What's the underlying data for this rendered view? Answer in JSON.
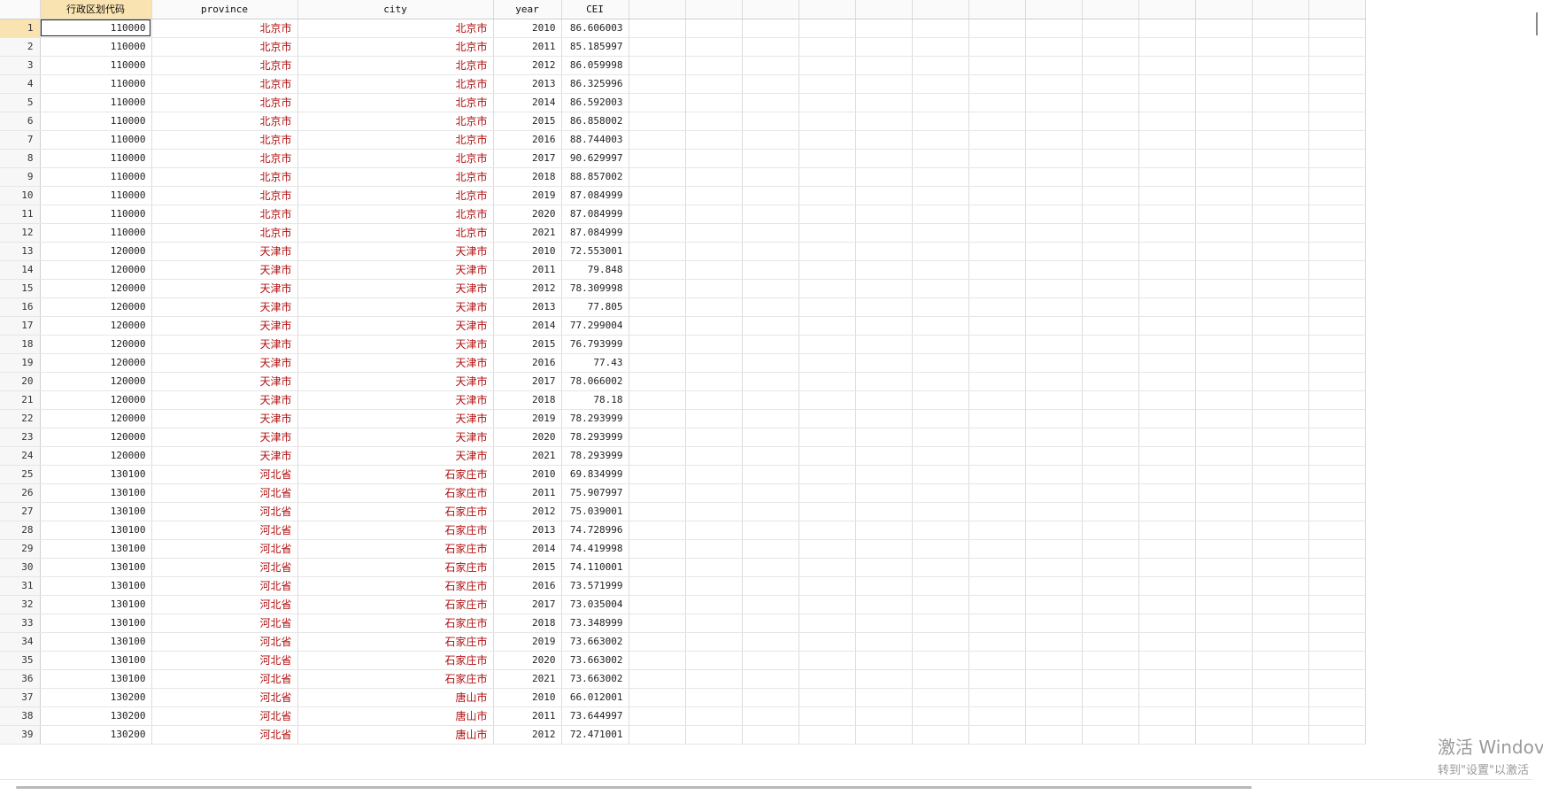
{
  "columns": [
    "行政区划代码",
    "province",
    "city",
    "year",
    "CEI"
  ],
  "selected_row": 1,
  "selected_column": "行政区划代码",
  "extra_empty_columns": 13,
  "rows": [
    [
      "1",
      "110000",
      "北京市",
      "北京市",
      "2010",
      "86.606003"
    ],
    [
      "2",
      "110000",
      "北京市",
      "北京市",
      "2011",
      "85.185997"
    ],
    [
      "3",
      "110000",
      "北京市",
      "北京市",
      "2012",
      "86.059998"
    ],
    [
      "4",
      "110000",
      "北京市",
      "北京市",
      "2013",
      "86.325996"
    ],
    [
      "5",
      "110000",
      "北京市",
      "北京市",
      "2014",
      "86.592003"
    ],
    [
      "6",
      "110000",
      "北京市",
      "北京市",
      "2015",
      "86.858002"
    ],
    [
      "7",
      "110000",
      "北京市",
      "北京市",
      "2016",
      "88.744003"
    ],
    [
      "8",
      "110000",
      "北京市",
      "北京市",
      "2017",
      "90.629997"
    ],
    [
      "9",
      "110000",
      "北京市",
      "北京市",
      "2018",
      "88.857002"
    ],
    [
      "10",
      "110000",
      "北京市",
      "北京市",
      "2019",
      "87.084999"
    ],
    [
      "11",
      "110000",
      "北京市",
      "北京市",
      "2020",
      "87.084999"
    ],
    [
      "12",
      "110000",
      "北京市",
      "北京市",
      "2021",
      "87.084999"
    ],
    [
      "13",
      "120000",
      "天津市",
      "天津市",
      "2010",
      "72.553001"
    ],
    [
      "14",
      "120000",
      "天津市",
      "天津市",
      "2011",
      "79.848"
    ],
    [
      "15",
      "120000",
      "天津市",
      "天津市",
      "2012",
      "78.309998"
    ],
    [
      "16",
      "120000",
      "天津市",
      "天津市",
      "2013",
      "77.805"
    ],
    [
      "17",
      "120000",
      "天津市",
      "天津市",
      "2014",
      "77.299004"
    ],
    [
      "18",
      "120000",
      "天津市",
      "天津市",
      "2015",
      "76.793999"
    ],
    [
      "19",
      "120000",
      "天津市",
      "天津市",
      "2016",
      "77.43"
    ],
    [
      "20",
      "120000",
      "天津市",
      "天津市",
      "2017",
      "78.066002"
    ],
    [
      "21",
      "120000",
      "天津市",
      "天津市",
      "2018",
      "78.18"
    ],
    [
      "22",
      "120000",
      "天津市",
      "天津市",
      "2019",
      "78.293999"
    ],
    [
      "23",
      "120000",
      "天津市",
      "天津市",
      "2020",
      "78.293999"
    ],
    [
      "24",
      "120000",
      "天津市",
      "天津市",
      "2021",
      "78.293999"
    ],
    [
      "25",
      "130100",
      "河北省",
      "石家庄市",
      "2010",
      "69.834999"
    ],
    [
      "26",
      "130100",
      "河北省",
      "石家庄市",
      "2011",
      "75.907997"
    ],
    [
      "27",
      "130100",
      "河北省",
      "石家庄市",
      "2012",
      "75.039001"
    ],
    [
      "28",
      "130100",
      "河北省",
      "石家庄市",
      "2013",
      "74.728996"
    ],
    [
      "29",
      "130100",
      "河北省",
      "石家庄市",
      "2014",
      "74.419998"
    ],
    [
      "30",
      "130100",
      "河北省",
      "石家庄市",
      "2015",
      "74.110001"
    ],
    [
      "31",
      "130100",
      "河北省",
      "石家庄市",
      "2016",
      "73.571999"
    ],
    [
      "32",
      "130100",
      "河北省",
      "石家庄市",
      "2017",
      "73.035004"
    ],
    [
      "33",
      "130100",
      "河北省",
      "石家庄市",
      "2018",
      "73.348999"
    ],
    [
      "34",
      "130100",
      "河北省",
      "石家庄市",
      "2019",
      "73.663002"
    ],
    [
      "35",
      "130100",
      "河北省",
      "石家庄市",
      "2020",
      "73.663002"
    ],
    [
      "36",
      "130100",
      "河北省",
      "石家庄市",
      "2021",
      "73.663002"
    ],
    [
      "37",
      "130200",
      "河北省",
      "唐山市",
      "2010",
      "66.012001"
    ],
    [
      "38",
      "130200",
      "河北省",
      "唐山市",
      "2011",
      "73.644997"
    ],
    [
      "39",
      "130200",
      "河北省",
      "唐山市",
      "2012",
      "72.471001"
    ]
  ],
  "watermark": {
    "line1": "激活 Windov",
    "line2": "转到\"设置\"以激活"
  },
  "colors": {
    "string_text": "#b01010",
    "selection_highlight": "#f9e3b0"
  }
}
